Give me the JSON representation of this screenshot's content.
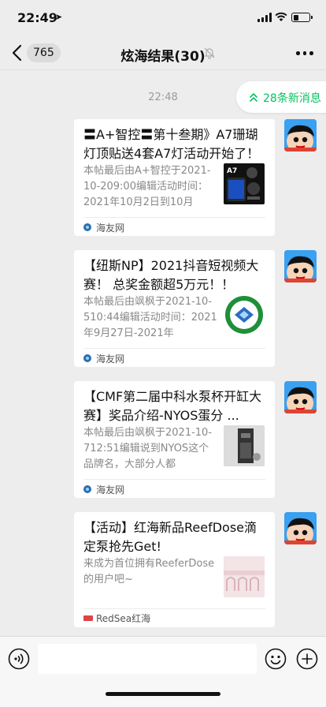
{
  "status_bar": {
    "time": "22:49",
    "location_arrow": "➤",
    "battery_level": 0.35
  },
  "nav": {
    "unread_count": "765",
    "title": "炫海结果(30)",
    "mute_icon": "bell-off-icon",
    "more_icon": "ellipsis-icon"
  },
  "timestamp": "22:48",
  "new_messages": {
    "label": "28条新消息",
    "color": "#07c160"
  },
  "messages": [
    {
      "title": "〓A+智控〓第十叁期》A7珊瑚灯顶贴送4套A7灯活动开始了！",
      "description": "本帖最后由A+智控于2021-10-209:00编辑活动时间：2021年10月2日到10月",
      "source": "海友网",
      "thumbnail_text": "A7"
    },
    {
      "title": "【纽斯NP】2021抖音短视频大赛！ 总奖金额超5万元！！",
      "description": "本帖最后由飒枫于2021-10-510:44编辑活动时间：2021年9月27日-2021年",
      "source": "海友网"
    },
    {
      "title": "【CMF第二届中科水泵杯开缸大赛】奖品介绍-NYOS蛋分 ...",
      "description": "本帖最后由飒枫于2021-10-712:51编辑说到NYOS这个品牌名，大部分人都",
      "source": "海友网"
    },
    {
      "title": "【活动】红海新品ReefDose滴定泵抢先Get!",
      "description": "来成为首位拥有ReeferDose的用户吧~",
      "source": "RedSea红海"
    }
  ],
  "input_bar": {
    "placeholder": "",
    "voice_icon": "voice-icon",
    "emoji_icon": "emoji-icon",
    "plus_icon": "plus-icon"
  }
}
